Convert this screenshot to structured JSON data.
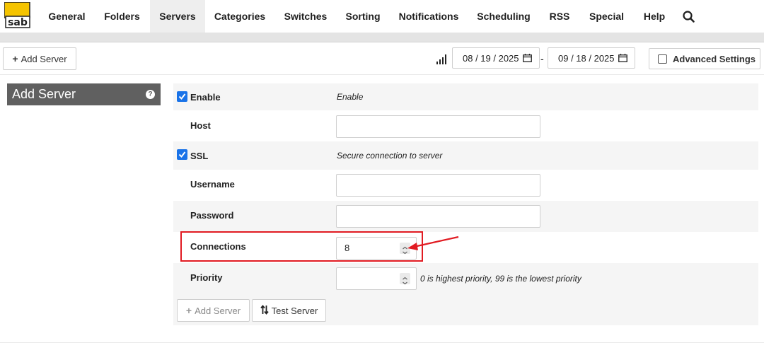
{
  "nav": {
    "items": [
      {
        "label": "General"
      },
      {
        "label": "Folders"
      },
      {
        "label": "Servers"
      },
      {
        "label": "Categories"
      },
      {
        "label": "Switches"
      },
      {
        "label": "Sorting"
      },
      {
        "label": "Notifications"
      },
      {
        "label": "Scheduling"
      },
      {
        "label": "RSS"
      },
      {
        "label": "Special"
      },
      {
        "label": "Help"
      }
    ],
    "active": "Servers",
    "logo_text": "sab",
    "search_icon": "search-icon"
  },
  "toolbar": {
    "add_server_label": "Add Server",
    "date_from": "08 / 19 / 2025",
    "date_separator": "-",
    "date_to": "09 / 18 / 2025",
    "advanced_settings_label": "Advanced Settings",
    "advanced_settings_checked": false
  },
  "sidebar": {
    "title": "Add Server",
    "help_glyph": "?"
  },
  "form": {
    "enable": {
      "label": "Enable",
      "description": "Enable",
      "checked": true
    },
    "host": {
      "label": "Host",
      "value": ""
    },
    "ssl": {
      "label": "SSL",
      "description": "Secure connection to server",
      "checked": true
    },
    "username": {
      "label": "Username",
      "value": ""
    },
    "password": {
      "label": "Password",
      "value": ""
    },
    "connections": {
      "label": "Connections",
      "value": "8"
    },
    "priority": {
      "label": "Priority",
      "value": "",
      "description": "0 is highest priority, 99 is the lowest priority"
    },
    "add_server_label": "Add Server",
    "test_server_label": "Test Server"
  },
  "colors": {
    "accent": "#1a73e8",
    "annotation": "#e11b22",
    "sidebar_title_bg": "#606060",
    "logo_yellow": "#f5c400"
  }
}
